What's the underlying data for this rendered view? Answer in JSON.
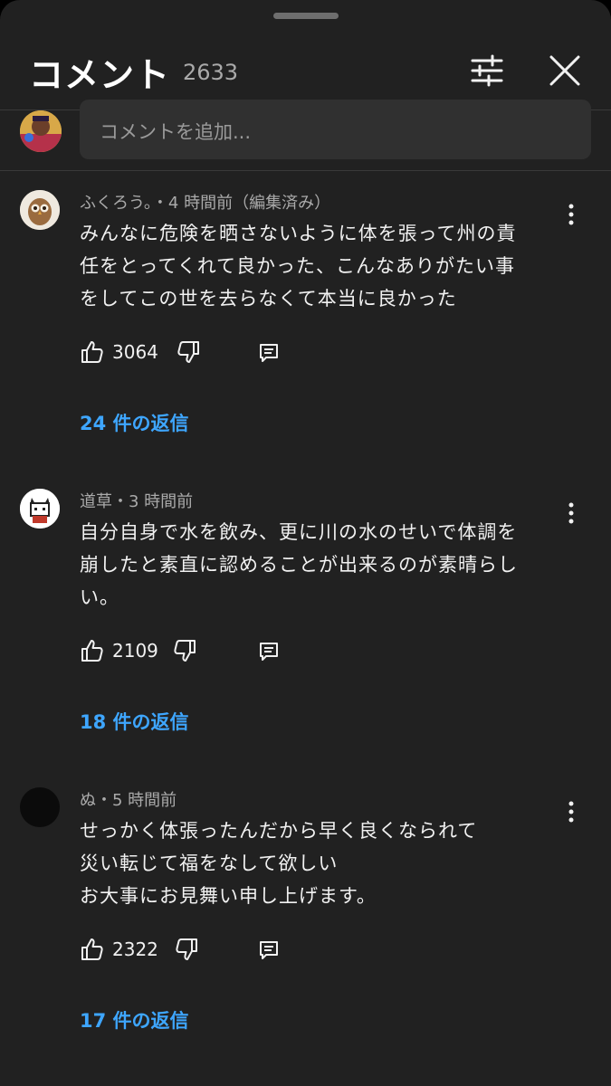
{
  "header": {
    "title": "コメント",
    "count": "2633"
  },
  "add_comment": {
    "placeholder": "コメントを追加..."
  },
  "comments": [
    {
      "author": "ふくろう。",
      "meta": "ふくろう。・4 時間前（編集済み）",
      "lines": [
        "みんなに危険を晒さないように体を張って州の責",
        "任をとってくれて良かった、こんなありがたい事",
        "をしてこの世を去らなくて本当に良かった"
      ],
      "likes": "3064",
      "replies": "24 件の返信"
    },
    {
      "author": "道草",
      "meta": "道草・3 時間前",
      "lines": [
        "自分自身で水を飲み、更に川の水のせいで体調を",
        "崩したと素直に認めることが出来るのが素晴らし",
        "い。"
      ],
      "likes": "2109",
      "replies": "18 件の返信"
    },
    {
      "author": "ぬ",
      "meta": "ぬ・5 時間前",
      "lines": [
        "せっかく体張ったんだから早く良くなられて",
        "災い転じて福をなして欲しい",
        "お大事にお見舞い申し上げます。"
      ],
      "likes": "2322",
      "replies": "17 件の返信"
    }
  ],
  "colors": {
    "background": "#212121",
    "accent_link": "#3ea6ff",
    "secondary_text": "#aaaaaa",
    "input_bg": "#303030"
  },
  "icons": [
    "filter-icon",
    "close-icon",
    "more-vert-icon",
    "like-icon",
    "dislike-icon",
    "reply-icon"
  ]
}
